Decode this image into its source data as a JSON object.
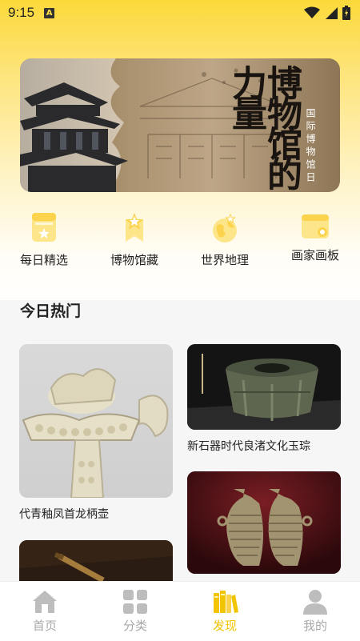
{
  "status_bar": {
    "time": "9:15",
    "notif_badge": "A",
    "icons": [
      "wifi-icon",
      "signal-icon",
      "battery-icon"
    ]
  },
  "banner": {
    "title": "博物馆的力量",
    "subtitle": "国际博物馆日"
  },
  "categories": [
    {
      "label": "每日精选",
      "icon": "daily-pick-icon"
    },
    {
      "label": "博物馆藏",
      "icon": "museum-collection-icon"
    },
    {
      "label": "世界地理",
      "icon": "globe-icon"
    },
    {
      "label": "画家画板",
      "icon": "painter-board-icon"
    }
  ],
  "hot": {
    "title": "今日热门",
    "cards": [
      {
        "caption": "代青釉凤首龙柄壶"
      },
      {
        "caption": "新石器时代良渚文化玉琮"
      },
      {
        "caption": ""
      },
      {
        "caption": ""
      }
    ]
  },
  "tabs": [
    {
      "label": "首页",
      "icon": "home-icon",
      "active": false
    },
    {
      "label": "分类",
      "icon": "grid-icon",
      "active": false
    },
    {
      "label": "发现",
      "icon": "books-icon",
      "active": true
    },
    {
      "label": "我的",
      "icon": "user-icon",
      "active": false
    }
  ],
  "colors": {
    "accent": "#f1c400",
    "header_yellow": "#fcd93a",
    "tab_inactive": "#a8a8a8"
  }
}
